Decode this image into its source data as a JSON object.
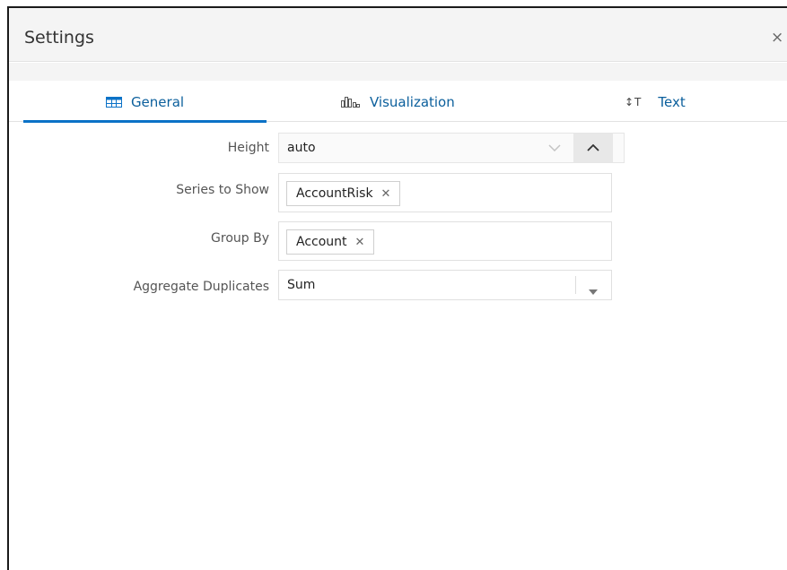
{
  "dialog": {
    "title": "Settings",
    "close_glyph": "×"
  },
  "tabs": [
    {
      "label": "General",
      "icon": "grid-table-icon",
      "selected": true
    },
    {
      "label": "Visualization",
      "icon": "bar-chart-icon",
      "selected": false
    },
    {
      "label": "Text",
      "icon": "text-size-icon",
      "icon_glyph": "↕T",
      "selected": false
    }
  ],
  "form": {
    "height": {
      "label": "Height",
      "value": "auto"
    },
    "series": {
      "label": "Series to Show",
      "chips": [
        "AccountRisk"
      ]
    },
    "group_by": {
      "label": "Group By",
      "chips": [
        "Account"
      ]
    },
    "aggregate": {
      "label": "Aggregate Duplicates",
      "value": "Sum"
    },
    "chip_remove_glyph": "✕"
  },
  "colors": {
    "accent": "#0b72c7",
    "tab_text": "#0b5f9c",
    "header_bg": "#f4f4f4"
  }
}
